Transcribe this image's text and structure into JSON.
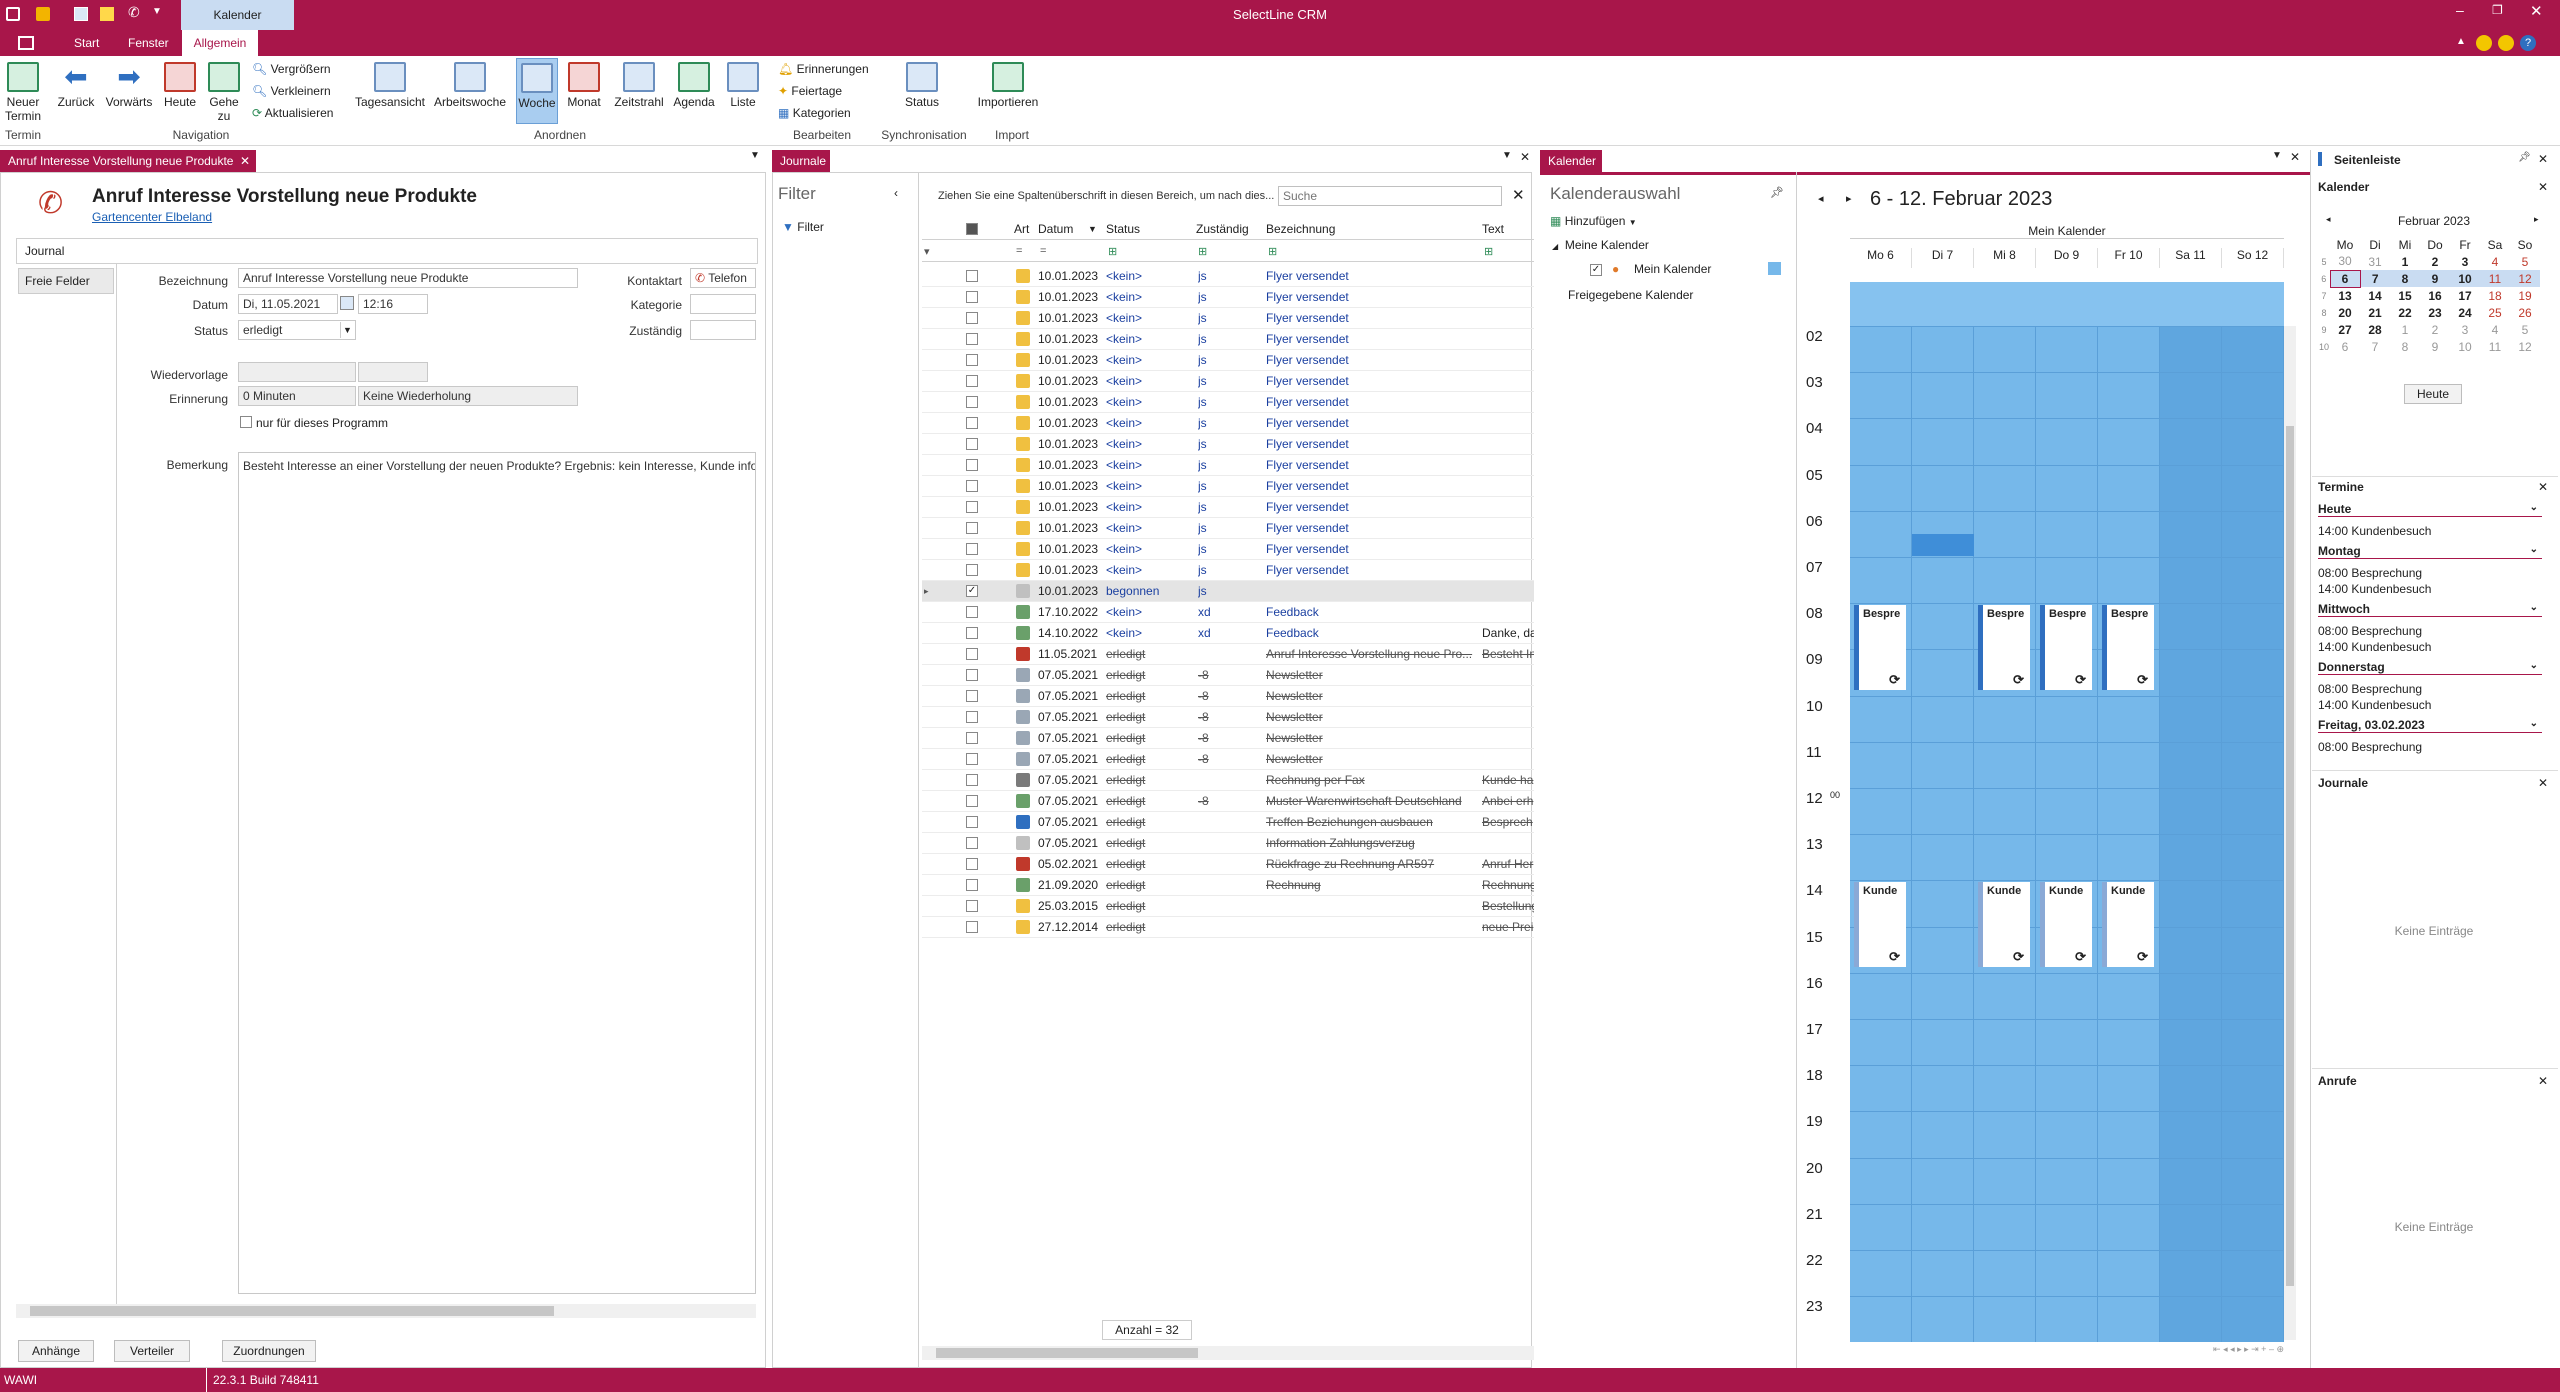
{
  "app": {
    "title": "SelectLine CRM",
    "context_tab": "Kalender"
  },
  "menu_tabs": [
    {
      "label": "Start"
    },
    {
      "label": "Fenster"
    },
    {
      "label": "Allgemein"
    }
  ],
  "ribbon": {
    "buttons": [
      {
        "label": "Neuer Termin",
        "name": "neuer-termin"
      },
      {
        "label": "Zurück",
        "name": "zurueck"
      },
      {
        "label": "Vorwärts",
        "name": "vorwaerts"
      },
      {
        "label": "Heute",
        "name": "heute"
      },
      {
        "label": "Gehe zu",
        "name": "gehe-zu"
      },
      {
        "label": "Tagesansicht",
        "name": "tagesansicht"
      },
      {
        "label": "Arbeitswoche",
        "name": "arbeitswoche"
      },
      {
        "label": "Woche",
        "name": "woche"
      },
      {
        "label": "Monat",
        "name": "monat"
      },
      {
        "label": "Zeitstrahl",
        "name": "zeitstrahl"
      },
      {
        "label": "Agenda",
        "name": "agenda"
      },
      {
        "label": "Liste",
        "name": "liste"
      },
      {
        "label": "Status",
        "name": "status"
      },
      {
        "label": "Importieren",
        "name": "importieren"
      }
    ],
    "small_buttons": {
      "vergroessern": "Vergrößern",
      "verkleinern": "Verkleinern",
      "aktualisieren": "Aktualisieren",
      "erinnerungen": "Erinnerungen",
      "feiertage": "Feiertage",
      "kategorien": "Kategorien"
    },
    "groups": {
      "termin": "Termin",
      "navigation": "Navigation",
      "anordnen": "Anordnen",
      "bearbeiten": "Bearbeiten",
      "synchronisation": "Synchronisation",
      "import": "Import"
    }
  },
  "detail": {
    "tab_title": "Anruf Interesse Vorstellung neue Produkte",
    "heading": "Anruf Interesse Vorstellung neue Produkte",
    "company_link": "Gartencenter Elbeland",
    "side_tabs": [
      "Journal",
      "Freie Felder"
    ],
    "labels": {
      "bezeichnung": "Bezeichnung",
      "datum": "Datum",
      "status": "Status",
      "kontaktart": "Kontaktart",
      "kategorie": "Kategorie",
      "zustaendig": "Zuständig",
      "wiedervorlage": "Wiedervorlage",
      "erinnerung": "Erinnerung",
      "bemerkung": "Bemerkung"
    },
    "values": {
      "bezeichnung": "Anruf Interesse Vorstellung neue Produkte",
      "datum": "Di, 11.05.2021",
      "uhrzeit": "12:16",
      "status": "erledigt",
      "kontaktart": "Telefon",
      "erinnerung": "0 Minuten",
      "wiederholung": "Keine Wiederholung",
      "nur_programm": "nur für dieses Programm",
      "bemerkung": "Besteht Interesse an einer Vorstellung der neuen Produkte? Ergebnis: kein Interesse, Kunde infor"
    },
    "bottom_tabs": [
      "Anhänge",
      "Verteiler",
      "Zuordnungen"
    ]
  },
  "journale": {
    "title": "Journale",
    "filter_title": "Filter",
    "filter_button": "Filter",
    "group_hint": "Ziehen Sie eine Spaltenüberschrift in diesen Bereich, um nach dies...",
    "search_placeholder": "Suche",
    "columns": [
      "Art",
      "Datum",
      "Status",
      "Zuständig",
      "Bezeichnung",
      "Text"
    ],
    "rows": [
      {
        "datum": "10.01.2023",
        "status": "<kein>",
        "zust": "js",
        "bez": "Flyer versendet",
        "text": "",
        "done": false,
        "icon": "journal"
      },
      {
        "datum": "10.01.2023",
        "status": "<kein>",
        "zust": "js",
        "bez": "Flyer versendet",
        "text": "",
        "done": false,
        "icon": "journal"
      },
      {
        "datum": "10.01.2023",
        "status": "<kein>",
        "zust": "js",
        "bez": "Flyer versendet",
        "text": "",
        "done": false,
        "icon": "journal"
      },
      {
        "datum": "10.01.2023",
        "status": "<kein>",
        "zust": "js",
        "bez": "Flyer versendet",
        "text": "",
        "done": false,
        "icon": "journal"
      },
      {
        "datum": "10.01.2023",
        "status": "<kein>",
        "zust": "js",
        "bez": "Flyer versendet",
        "text": "",
        "done": false,
        "icon": "journal"
      },
      {
        "datum": "10.01.2023",
        "status": "<kein>",
        "zust": "js",
        "bez": "Flyer versendet",
        "text": "",
        "done": false,
        "icon": "journal"
      },
      {
        "datum": "10.01.2023",
        "status": "<kein>",
        "zust": "js",
        "bez": "Flyer versendet",
        "text": "",
        "done": false,
        "icon": "journal"
      },
      {
        "datum": "10.01.2023",
        "status": "<kein>",
        "zust": "js",
        "bez": "Flyer versendet",
        "text": "",
        "done": false,
        "icon": "journal"
      },
      {
        "datum": "10.01.2023",
        "status": "<kein>",
        "zust": "js",
        "bez": "Flyer versendet",
        "text": "",
        "done": false,
        "icon": "journal"
      },
      {
        "datum": "10.01.2023",
        "status": "<kein>",
        "zust": "js",
        "bez": "Flyer versendet",
        "text": "",
        "done": false,
        "icon": "journal"
      },
      {
        "datum": "10.01.2023",
        "status": "<kein>",
        "zust": "js",
        "bez": "Flyer versendet",
        "text": "",
        "done": false,
        "icon": "journal"
      },
      {
        "datum": "10.01.2023",
        "status": "<kein>",
        "zust": "js",
        "bez": "Flyer versendet",
        "text": "",
        "done": false,
        "icon": "journal"
      },
      {
        "datum": "10.01.2023",
        "status": "<kein>",
        "zust": "js",
        "bez": "Flyer versendet",
        "text": "",
        "done": false,
        "icon": "journal"
      },
      {
        "datum": "10.01.2023",
        "status": "<kein>",
        "zust": "js",
        "bez": "Flyer versendet",
        "text": "",
        "done": false,
        "icon": "journal"
      },
      {
        "datum": "10.01.2023",
        "status": "<kein>",
        "zust": "js",
        "bez": "Flyer versendet",
        "text": "",
        "done": false,
        "icon": "journal"
      },
      {
        "datum": "10.01.2023 (",
        "status": "begonnen",
        "zust": "js",
        "bez": "",
        "text": "",
        "done": false,
        "icon": "note",
        "selected": true
      },
      {
        "datum": "17.10.2022 (",
        "status": "<kein>",
        "zust": "xd",
        "bez": "Feedback",
        "text": "",
        "done": false,
        "icon": "mail"
      },
      {
        "datum": "14.10.2022 (",
        "status": "<kein>",
        "zust": "xd",
        "bez": "Feedback",
        "text": "Danke, da",
        "done": false,
        "icon": "mail"
      },
      {
        "datum": "11.05.2021",
        "status": "erledigt",
        "zust": "",
        "bez": "Anruf Interesse Vorstellung neue Pro...",
        "text": "Besteht In",
        "done": true,
        "icon": "phone"
      },
      {
        "datum": "07.05.2021",
        "status": "erledigt",
        "zust": "-8",
        "bez": "Newsletter",
        "text": "",
        "done": true,
        "icon": "copy"
      },
      {
        "datum": "07.05.2021",
        "status": "erledigt",
        "zust": "-8",
        "bez": "Newsletter",
        "text": "",
        "done": true,
        "icon": "copy"
      },
      {
        "datum": "07.05.2021",
        "status": "erledigt",
        "zust": "-8",
        "bez": "Newsletter",
        "text": "",
        "done": true,
        "icon": "copy"
      },
      {
        "datum": "07.05.2021",
        "status": "erledigt",
        "zust": "-8",
        "bez": "Newsletter",
        "text": "",
        "done": true,
        "icon": "copy"
      },
      {
        "datum": "07.05.2021",
        "status": "erledigt",
        "zust": "-8",
        "bez": "Newsletter",
        "text": "",
        "done": true,
        "icon": "copy"
      },
      {
        "datum": "07.05.2021",
        "status": "erledigt",
        "zust": "",
        "bez": "Rechnung per Fax",
        "text": "Kunde ha",
        "done": true,
        "icon": "fax"
      },
      {
        "datum": "07.05.2021",
        "status": "erledigt",
        "zust": "-8",
        "bez": "Muster Warenwirtschaft Deutschland",
        "text": "Anbei erh",
        "done": true,
        "icon": "mail"
      },
      {
        "datum": "07.05.2021",
        "status": "erledigt",
        "zust": "",
        "bez": "Treffen Beziehungen ausbauen",
        "text": "Besprech",
        "done": true,
        "icon": "car"
      },
      {
        "datum": "07.05.2021",
        "status": "erledigt",
        "zust": "",
        "bez": "Information Zahlungsverzug",
        "text": "",
        "done": true,
        "icon": "note"
      },
      {
        "datum": "05.02.2021",
        "status": "erledigt",
        "zust": "",
        "bez": "Rückfrage zu Rechnung AR597",
        "text": "Anruf Her",
        "done": true,
        "icon": "phone"
      },
      {
        "datum": "21.09.2020 (",
        "status": "erledigt",
        "zust": "",
        "bez": "Rechnung",
        "text": "Rechnung",
        "done": true,
        "icon": "mail"
      },
      {
        "datum": "25.03.2015 (",
        "status": "erledigt",
        "zust": "",
        "bez": "",
        "text": "Bestellung",
        "done": true,
        "icon": "journal"
      },
      {
        "datum": "27.12.2014 (",
        "status": "erledigt",
        "zust": "",
        "bez": "",
        "text": "neue Prei",
        "done": true,
        "icon": "journal"
      }
    ],
    "count": "Anzahl = 32"
  },
  "kalender": {
    "title": "Kalender",
    "auswahl_title": "Kalenderauswahl",
    "add_label": "Hinzufügen",
    "my_calendars": "Meine Kalender",
    "my_calendar": "Mein Kalender",
    "shared": "Freigegebene Kalender",
    "range": "6 - 12. Februar 2023",
    "calendar_name": "Mein Kalender",
    "days": [
      "Mo 6",
      "Di 7",
      "Mi 8",
      "Do 9",
      "Fr 10",
      "Sa 11",
      "So 12"
    ],
    "hours": [
      "02",
      "03",
      "04",
      "05",
      "06",
      "07",
      "08",
      "09",
      "10",
      "11",
      "12",
      "13",
      "14",
      "15",
      "16",
      "17",
      "18",
      "19",
      "20",
      "21",
      "22",
      "23"
    ],
    "noon_suffix": "00",
    "appointments": [
      {
        "day": 0,
        "title": "Bespre",
        "kind": "solid",
        "row": "am"
      },
      {
        "day": 2,
        "title": "Bespre",
        "kind": "solid",
        "row": "am"
      },
      {
        "day": 3,
        "title": "Bespre",
        "kind": "solid",
        "row": "am"
      },
      {
        "day": 4,
        "title": "Bespre",
        "kind": "solid",
        "row": "am"
      },
      {
        "day": 0,
        "title": "Kunde",
        "kind": "hatch",
        "row": "pm"
      },
      {
        "day": 2,
        "title": "Kunde",
        "kind": "hatch",
        "row": "pm"
      },
      {
        "day": 3,
        "title": "Kunde",
        "kind": "hatch",
        "row": "pm"
      },
      {
        "day": 4,
        "title": "Kunde",
        "kind": "hatch",
        "row": "pm"
      }
    ]
  },
  "sidebar": {
    "title": "Seitenleiste",
    "kalender_title": "Kalender",
    "month": "Februar 2023",
    "weekday_heads": [
      "Mo",
      "Di",
      "Mi",
      "Do",
      "Fr",
      "Sa",
      "So"
    ],
    "weeks": [
      {
        "kw": "5",
        "days": [
          "30",
          "31",
          "1",
          "2",
          "3",
          "4",
          "5"
        ]
      },
      {
        "kw": "6",
        "days": [
          "6",
          "7",
          "8",
          "9",
          "10",
          "11",
          "12"
        ]
      },
      {
        "kw": "7",
        "days": [
          "13",
          "14",
          "15",
          "16",
          "17",
          "18",
          "19"
        ]
      },
      {
        "kw": "8",
        "days": [
          "20",
          "21",
          "22",
          "23",
          "24",
          "25",
          "26"
        ]
      },
      {
        "kw": "9",
        "days": [
          "27",
          "28",
          "1",
          "2",
          "3",
          "4",
          "5"
        ]
      },
      {
        "kw": "10",
        "days": [
          "6",
          "7",
          "8",
          "9",
          "10",
          "11",
          "12"
        ]
      }
    ],
    "today_button": "Heute",
    "termine_title": "Termine",
    "termine": [
      {
        "day": "Heute",
        "events": [
          "14:00 Kundenbesuch"
        ]
      },
      {
        "day": "Montag",
        "events": [
          "08:00 Besprechung",
          "14:00 Kundenbesuch"
        ]
      },
      {
        "day": "Mittwoch",
        "events": [
          "08:00 Besprechung",
          "14:00 Kundenbesuch"
        ]
      },
      {
        "day": "Donnerstag",
        "events": [
          "08:00 Besprechung",
          "14:00 Kundenbesuch"
        ]
      },
      {
        "day": "Freitag, 03.02.2023",
        "events": [
          "08:00 Besprechung"
        ]
      }
    ],
    "journale_title": "Journale",
    "journale_empty": "Keine Einträge",
    "anrufe_title": "Anrufe",
    "anrufe_empty": "Keine Einträge"
  },
  "status_bar": {
    "mode": "WAWI",
    "build": "22.3.1 Build 748411"
  },
  "colors": {
    "brand": "#a8164a",
    "calendar_blue": "#76b8ea",
    "calendar_dark": "#5fa6df"
  }
}
